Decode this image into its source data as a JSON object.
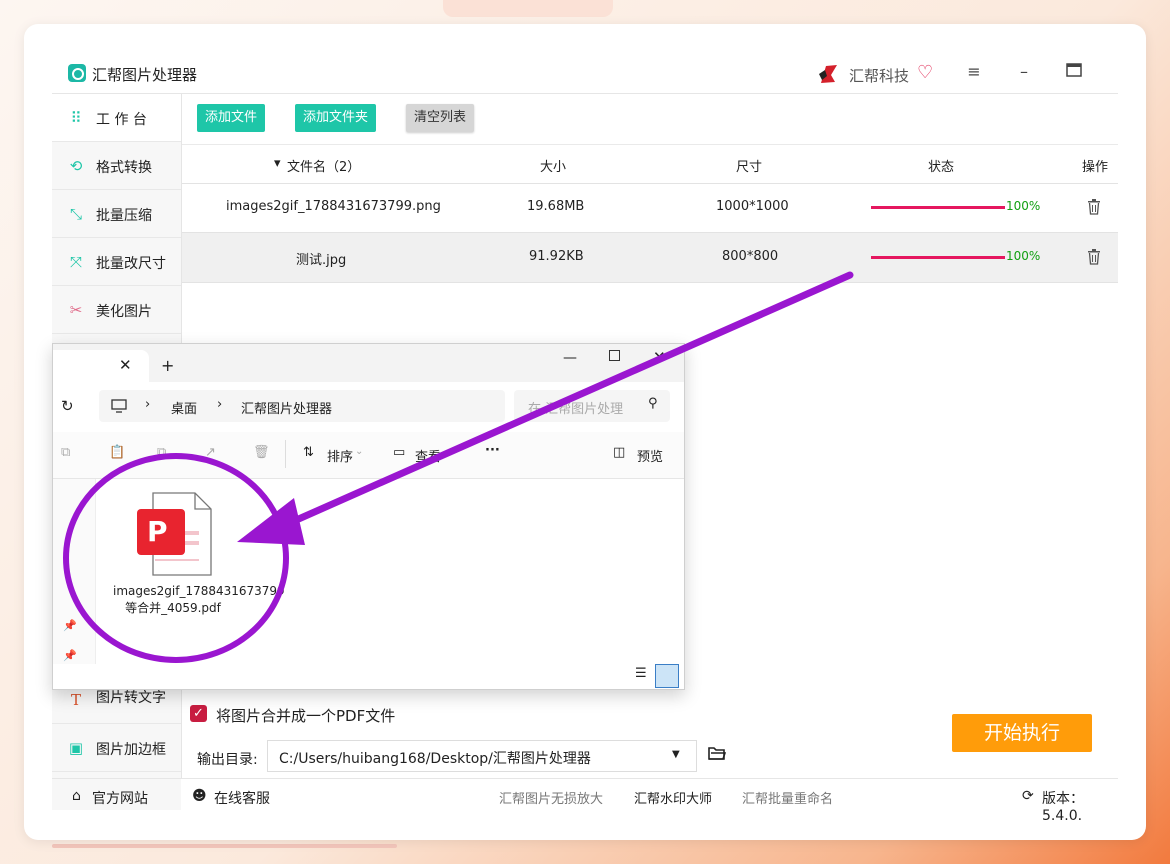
{
  "app": {
    "title": "汇帮图片处理器",
    "brand": "汇帮科技",
    "menu_icon": "hamburger-icon",
    "min_icon": "minimize-icon",
    "max_icon": "maximize-icon"
  },
  "sidebar": {
    "items": [
      {
        "label": "工 作 台",
        "icon": "grid-icon"
      },
      {
        "label": "格式转换",
        "icon": "convert-icon"
      },
      {
        "label": "批量压缩",
        "icon": "compress-icon"
      },
      {
        "label": "批量改尺寸",
        "icon": "resize-icon"
      },
      {
        "label": "美化图片",
        "icon": "beautify-icon"
      },
      {
        "label": "图片转文字",
        "icon": "text-icon"
      },
      {
        "label": "图片加边框",
        "icon": "frame-icon"
      }
    ]
  },
  "toolbar": {
    "add_file": "添加文件",
    "add_folder": "添加文件夹",
    "clear_list": "清空列表"
  },
  "table": {
    "columns": [
      "文件名（2）",
      "大小",
      "尺寸",
      "状态",
      "操作"
    ],
    "rows": [
      {
        "name": "images2gif_1788431673799.png",
        "size": "19.68MB",
        "dims": "1000*1000",
        "progress": 1.0,
        "status": "100%"
      },
      {
        "name": "测试.jpg",
        "size": "91.92KB",
        "dims": "800*800",
        "progress": 1.0,
        "status": "100%"
      }
    ]
  },
  "options": {
    "merge_pdf_label": "将图片合并成一个PDF文件",
    "merge_pdf_checked": true,
    "output_label": "输出目录:",
    "output_path": "C:/Users/huibang168/Desktop/汇帮图片处理器",
    "start_button": "开始执行"
  },
  "footer": {
    "website": "官方网站",
    "support": "在线客服",
    "link1": "汇帮图片无损放大",
    "link2": "汇帮水印大师",
    "link3": "汇帮批量重命名",
    "version": "版本：5.4.0."
  },
  "explorer": {
    "breadcrumb": [
      "桌面",
      "汇帮图片处理器"
    ],
    "search_placeholder": "在 汇帮图片处理",
    "sort_label": "排序",
    "view_label": "查看",
    "more_label": "···",
    "preview_label": "预览",
    "file_name": "images2gif_1788431673799等合并_4059.pdf"
  },
  "colors": {
    "accent": "#1ec6a8",
    "progress": "#e5175f",
    "progress_text": "#12a012",
    "start": "#ff9c0a",
    "annotation": "#9a16d0",
    "checkbox": "#c81d41"
  }
}
